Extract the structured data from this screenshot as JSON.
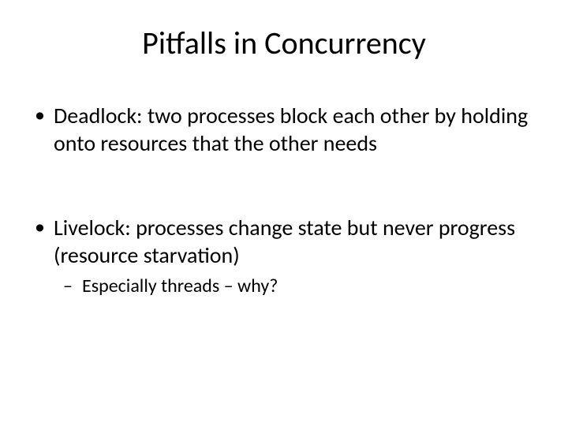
{
  "slide": {
    "title": "Pitfalls in Concurrency",
    "bullets": [
      {
        "text": "Deadlock: two processes block each other by holding onto resources that the other needs"
      },
      {
        "text": "Livelock: processes change state but never progress (resource starvation)",
        "sub": [
          {
            "text": "Especially threads – why?"
          }
        ]
      }
    ]
  }
}
